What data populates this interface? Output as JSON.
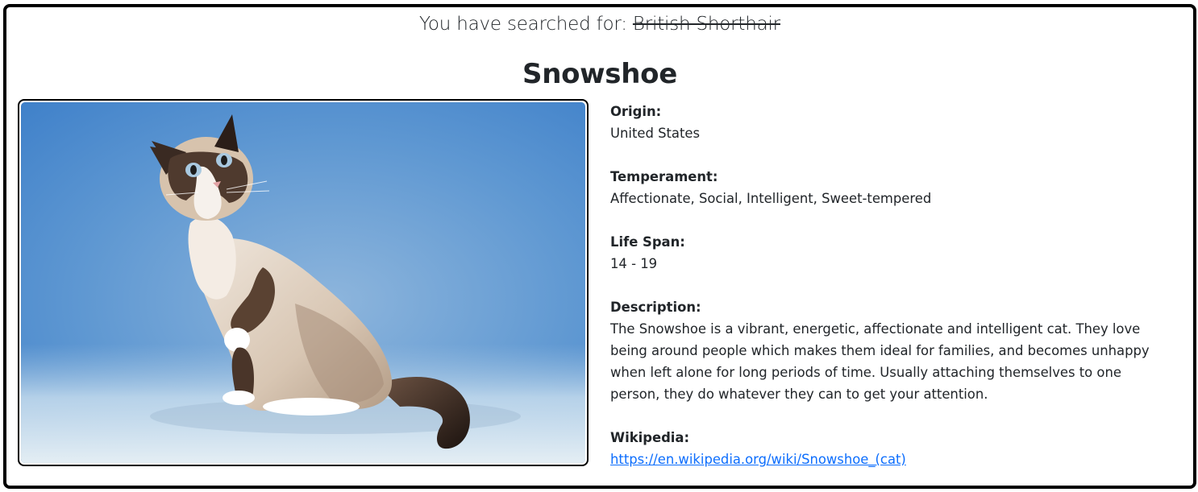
{
  "search": {
    "prefix": "You have searched for:",
    "query": "British Shorthair"
  },
  "breed": {
    "name": "Snowshoe",
    "origin_label": "Origin:",
    "origin": "United States",
    "temperament_label": "Temperament:",
    "temperament": "Affectionate, Social, Intelligent, Sweet-tempered",
    "life_span_label": "Life Span:",
    "life_span": "14 - 19",
    "description_label": "Description:",
    "description": "The Snowshoe is a vibrant, energetic, affectionate and intelligent cat. They love being around people which makes them ideal for families, and becomes unhappy when left alone for long periods of time. Usually attaching themselves to one person, they do whatever they can to get your attention.",
    "wikipedia_label": "Wikipedia:",
    "wikipedia_url": "https://en.wikipedia.org/wiki/Snowshoe_(cat)"
  },
  "colors": {
    "frame_border": "#000000",
    "text": "#212529",
    "link": "#0d6efd",
    "photo_background": "#4a8fd4"
  }
}
